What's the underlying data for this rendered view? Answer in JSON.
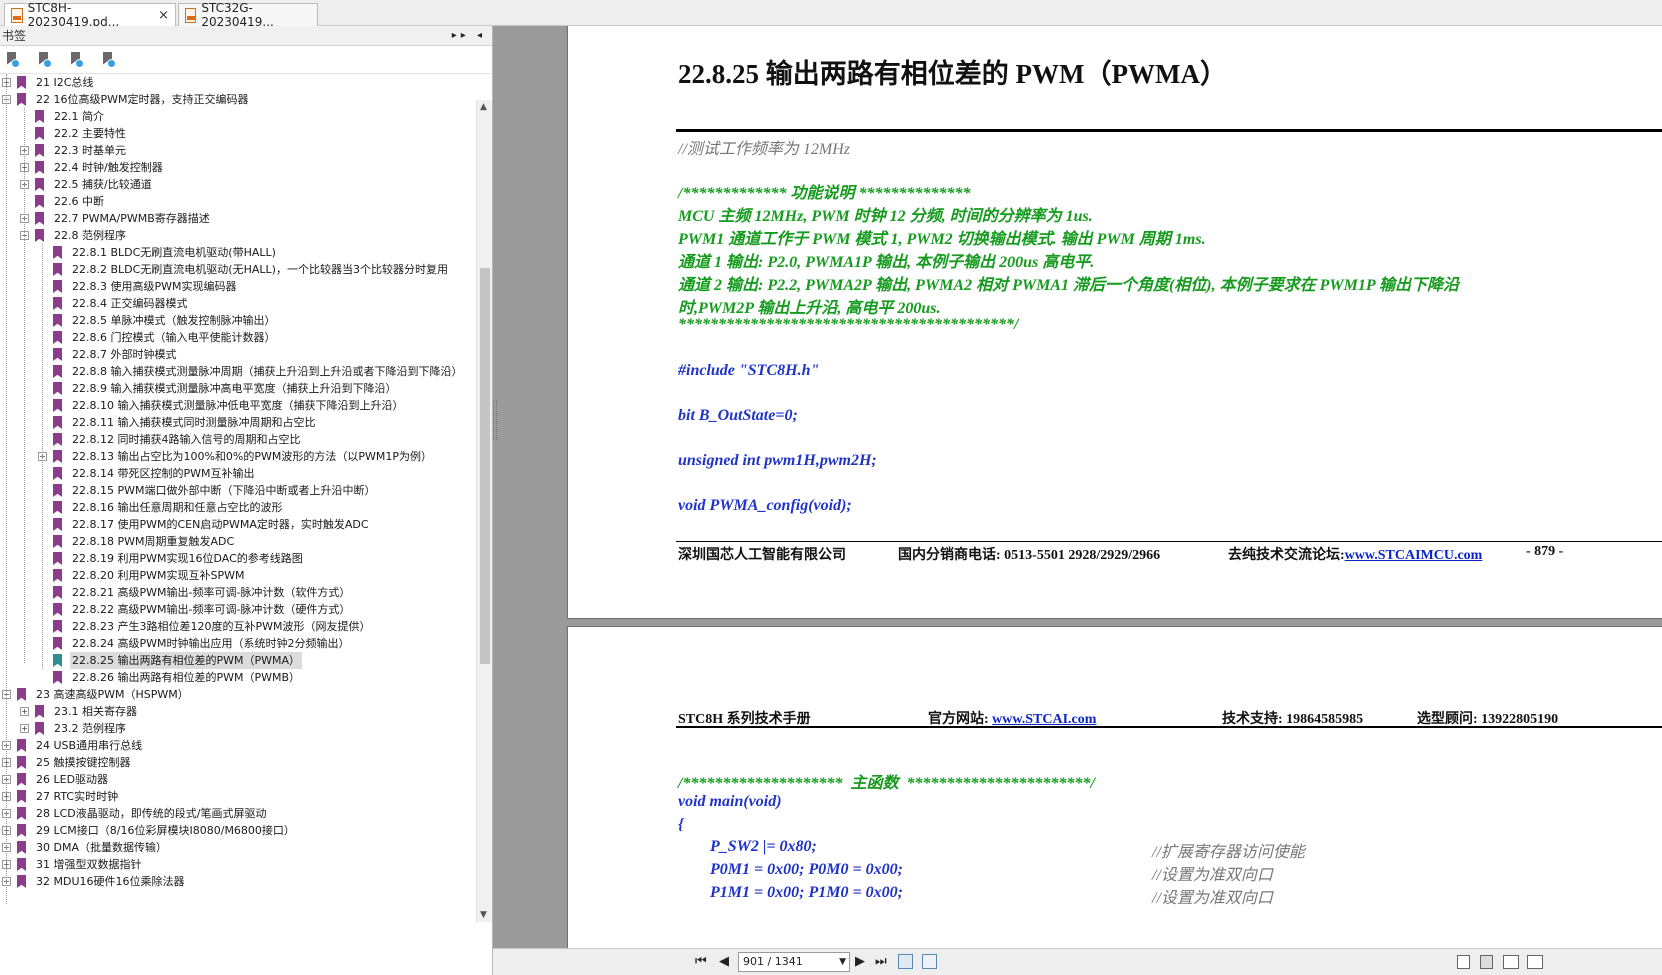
{
  "tabs": [
    {
      "title": "STC8H-20230419.pd...",
      "close": "×",
      "active": true
    },
    {
      "title": "STC32G-20230419...",
      "active": false
    }
  ],
  "sidebar": {
    "title": "书签",
    "controls": "▸▸ ◂",
    "tools": [
      "bookmark-icon",
      "bookmark-add-icon",
      "bookmark-expand-icon",
      "bookmark-find-icon"
    ],
    "items": [
      {
        "level": 0,
        "exp": "+",
        "label": "21 I2C总线"
      },
      {
        "level": 0,
        "exp": "−",
        "label": "22 16位高级PWM定时器，支持正交编码器"
      },
      {
        "level": 1,
        "exp": "",
        "label": "22.1 简介"
      },
      {
        "level": 1,
        "exp": "",
        "label": "22.2 主要特性"
      },
      {
        "level": 1,
        "exp": "+",
        "label": "22.3 时基单元"
      },
      {
        "level": 1,
        "exp": "+",
        "label": "22.4 时钟/触发控制器"
      },
      {
        "level": 1,
        "exp": "+",
        "label": "22.5 捕获/比较通道"
      },
      {
        "level": 1,
        "exp": "",
        "label": "22.6 中断"
      },
      {
        "level": 1,
        "exp": "+",
        "label": "22.7 PWMA/PWMB寄存器描述"
      },
      {
        "level": 1,
        "exp": "−",
        "label": "22.8 范例程序"
      },
      {
        "level": 2,
        "exp": "",
        "label": "22.8.1 BLDC无刷直流电机驱动(带HALL)"
      },
      {
        "level": 2,
        "exp": "",
        "label": "22.8.2 BLDC无刷直流电机驱动(无HALL)，一个比较器当3个比较器分时复用"
      },
      {
        "level": 2,
        "exp": "",
        "label": "22.8.3 使用高级PWM实现编码器"
      },
      {
        "level": 2,
        "exp": "",
        "label": "22.8.4 正交编码器模式"
      },
      {
        "level": 2,
        "exp": "",
        "label": "22.8.5 单脉冲模式（触发控制脉冲输出）"
      },
      {
        "level": 2,
        "exp": "",
        "label": "22.8.6 门控模式（输入电平使能计数器）"
      },
      {
        "level": 2,
        "exp": "",
        "label": "22.8.7 外部时钟模式"
      },
      {
        "level": 2,
        "exp": "",
        "label": "22.8.8 输入捕获模式测量脉冲周期（捕获上升沿到上升沿或者下降沿到下降沿）"
      },
      {
        "level": 2,
        "exp": "",
        "label": "22.8.9 输入捕获模式测量脉冲高电平宽度（捕获上升沿到下降沿）"
      },
      {
        "level": 2,
        "exp": "",
        "label": "22.8.10 输入捕获模式测量脉冲低电平宽度（捕获下降沿到上升沿）"
      },
      {
        "level": 2,
        "exp": "",
        "label": "22.8.11 输入捕获模式同时测量脉冲周期和占空比"
      },
      {
        "level": 2,
        "exp": "",
        "label": "22.8.12 同时捕获4路输入信号的周期和占空比"
      },
      {
        "level": 2,
        "exp": "+",
        "label": "22.8.13 输出占空比为100%和0%的PWM波形的方法（以PWM1P为例）"
      },
      {
        "level": 2,
        "exp": "",
        "label": "22.8.14 带死区控制的PWM互补输出"
      },
      {
        "level": 2,
        "exp": "",
        "label": "22.8.15 PWM端口做外部中断（下降沿中断或者上升沿中断）"
      },
      {
        "level": 2,
        "exp": "",
        "label": "22.8.16 输出任意周期和任意占空比的波形"
      },
      {
        "level": 2,
        "exp": "",
        "label": "22.8.17 使用PWM的CEN启动PWMA定时器，实时触发ADC"
      },
      {
        "level": 2,
        "exp": "",
        "label": "22.8.18 PWM周期重复触发ADC"
      },
      {
        "level": 2,
        "exp": "",
        "label": "22.8.19 利用PWM实现16位DAC的参考线路图"
      },
      {
        "level": 2,
        "exp": "",
        "label": "22.8.20 利用PWM实现互补SPWM"
      },
      {
        "level": 2,
        "exp": "",
        "label": "22.8.21 高级PWM输出-频率可调-脉冲计数（软件方式）"
      },
      {
        "level": 2,
        "exp": "",
        "label": "22.8.22 高级PWM输出-频率可调-脉冲计数（硬件方式）"
      },
      {
        "level": 2,
        "exp": "",
        "label": "22.8.23 产生3路相位差120度的互补PWM波形（网友提供）"
      },
      {
        "level": 2,
        "exp": "",
        "label": "22.8.24 高级PWM时钟输出应用（系统时钟2分频输出）"
      },
      {
        "level": 2,
        "exp": "",
        "label": "22.8.25 输出两路有相位差的PWM（PWMA）",
        "selected": true
      },
      {
        "level": 2,
        "exp": "",
        "label": "22.8.26 输出两路有相位差的PWM（PWMB）"
      },
      {
        "level": 0,
        "exp": "−",
        "label": "23 高速高级PWM（HSPWM）"
      },
      {
        "level": 1,
        "exp": "+",
        "label": "23.1 相关寄存器"
      },
      {
        "level": 1,
        "exp": "+",
        "label": "23.2 范例程序"
      },
      {
        "level": 0,
        "exp": "+",
        "label": "24 USB通用串行总线"
      },
      {
        "level": 0,
        "exp": "+",
        "label": "25 触摸按键控制器"
      },
      {
        "level": 0,
        "exp": "+",
        "label": "26 LED驱动器"
      },
      {
        "level": 0,
        "exp": "+",
        "label": "27 RTC实时时钟"
      },
      {
        "level": 0,
        "exp": "+",
        "label": "28 LCD液晶驱动，即传统的段式/笔画式屏驱动"
      },
      {
        "level": 0,
        "exp": "+",
        "label": "29 LCM接口（8/16位彩屏模块I8080/M6800接口）"
      },
      {
        "level": 0,
        "exp": "+",
        "label": "30 DMA（批量数据传输）"
      },
      {
        "level": 0,
        "exp": "+",
        "label": "31 增强型双数据指针"
      },
      {
        "level": 0,
        "exp": "+",
        "label": "32 MDU16硬件16位乘除法器"
      }
    ]
  },
  "page1": {
    "heading": "22.8.25  输出两路有相位差的 PWM（PWMA）",
    "lines": [
      {
        "cls": "gray-i",
        "text": "//测试工作频率为 12MHz"
      },
      {
        "cls": "green",
        "text": "/*************  功能说明  **************"
      },
      {
        "cls": "green",
        "text": "MCU 主频 12MHz, PWM 时钟 12 分频, 时间的分辨率为 1us."
      },
      {
        "cls": "green",
        "text": "PWM1 通道工作于 PWM 模式 1, PWM2 切换输出模式. 输出 PWM 周期 1ms."
      },
      {
        "cls": "green",
        "text": "通道 1 输出: P2.0, PWMA1P 输出, 本例子输出 200us 高电平."
      },
      {
        "cls": "green",
        "text": "通道  2  输出:  P2.2,  PWMA2P  输出,  PWMA2  相对  PWMA1  滞后一个角度(相位),  本例子要求在  PWM1P  输出下降沿"
      },
      {
        "cls": "green",
        "text": "时,PWM2P 输出上升沿, 高电平 200us."
      },
      {
        "cls": "green",
        "text": "******************************************/"
      },
      {
        "cls": "blue",
        "text": "#include \"STC8H.h\""
      },
      {
        "cls": "blue",
        "text": "bit B_OutState=0;"
      },
      {
        "cls": "blue",
        "text": "unsigned int pwm1H,pwm2H;"
      },
      {
        "cls": "blue",
        "text": "void PWMA_config(void);"
      }
    ],
    "footer": {
      "company": "深圳国芯人工智能有限公司",
      "phone": "国内分销商电话: 0513-5501 2928/2929/2966",
      "forum_label": "去纯技术交流论坛:",
      "forum_link": "www.STCAIMCU.com",
      "page_no": "- 879 -"
    }
  },
  "page2": {
    "header": {
      "manual": "STC8H 系列技术手册",
      "site_label": "官方网站: ",
      "site_link": "www.STCAI.com",
      "support": "技术支持: 19864585985",
      "advisor": "选型顾问: 13922805190"
    },
    "code": [
      {
        "cls": "green",
        "text": "/********************  主函数  ***********************/",
        "comment": ""
      },
      {
        "cls": "blue",
        "text": "void main(void)",
        "comment": ""
      },
      {
        "cls": "blue",
        "text": "{",
        "comment": ""
      },
      {
        "cls": "blue",
        "text": "        P_SW2 |= 0x80;",
        "comment": "//扩展寄存器访问使能"
      },
      {
        "cls": "blue",
        "text": "        P0M1 = 0x00; P0M0 = 0x00;",
        "comment": "//设置为准双向口"
      },
      {
        "cls": "blue",
        "text": "        P1M1 = 0x00; P1M0 = 0x00;",
        "comment": "//设置为准双向口"
      }
    ]
  },
  "statusbar": {
    "page_indicator": "901 / 1341",
    "first": "⏮",
    "prev": "◀",
    "next": "▶",
    "last": "⏭"
  }
}
